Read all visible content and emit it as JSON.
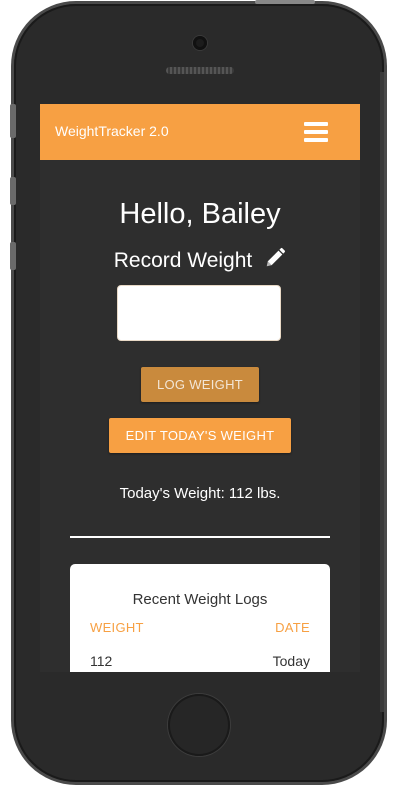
{
  "app": {
    "brand": "WeightTracker 2.0",
    "accent_color": "#f7a043"
  },
  "navbar": {
    "menu_icon": "hamburger-menu-icon"
  },
  "main": {
    "greeting": "Hello, Bailey",
    "record_label": "Record Weight",
    "record_icon": "pencil-icon",
    "weight_input": {
      "value": "",
      "placeholder": ""
    },
    "log_button": "LOG WEIGHT",
    "edit_button": "EDIT TODAY'S WEIGHT",
    "todays_weight": "Today's Weight: 112 lbs."
  },
  "logs": {
    "title": "Recent Weight Logs",
    "columns": [
      "WEIGHT",
      "DATE"
    ],
    "rows": [
      {
        "weight": "112",
        "date": "Today"
      }
    ]
  }
}
